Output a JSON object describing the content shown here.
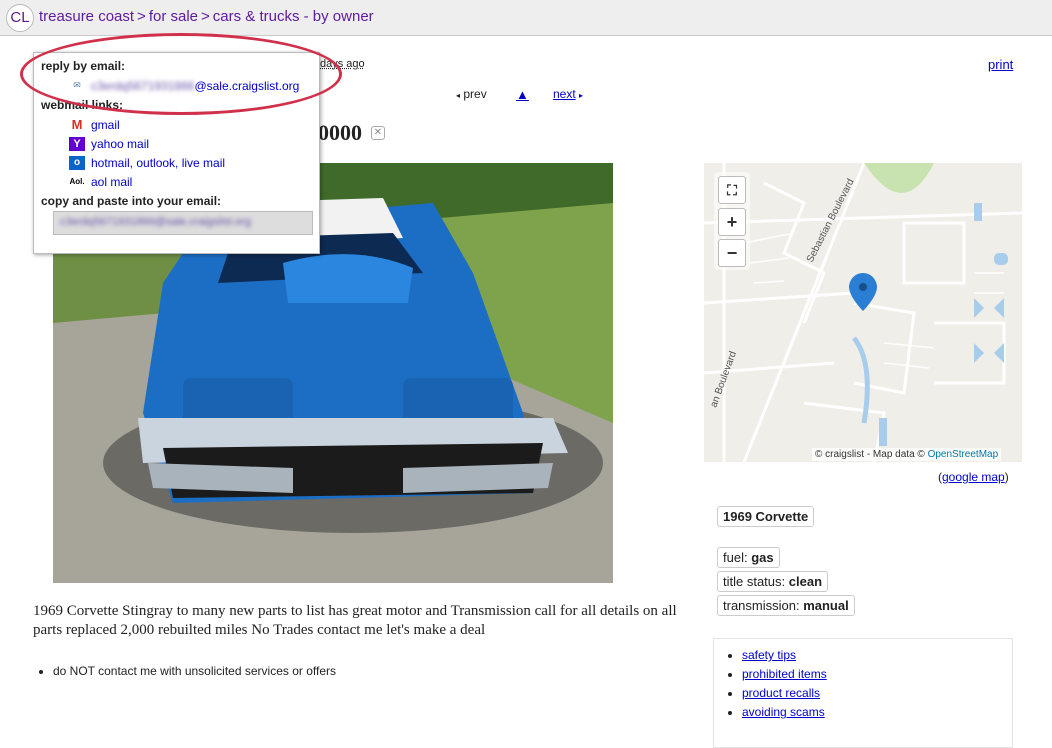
{
  "header": {
    "logo": "CL",
    "breadcrumbs": [
      "treasure coast",
      "for sale",
      "cars & trucks - by owner"
    ],
    "separator": ">"
  },
  "posting": {
    "posted_fragment": "days ago",
    "print_label": "print",
    "prev_label": "prev",
    "up_label": "▲",
    "next_label": "next",
    "title_fragment": "0000",
    "body": "1969 Corvette Stingray to many new parts to list has great motor and Transmission call for all details on all parts replaced 2,000 rebuilted miles No Trades contact me let's make a deal",
    "notices": [
      "do NOT contact me with unsolicited services or offers"
    ]
  },
  "reply_popup": {
    "reply_heading": "reply by email:",
    "email_user_blurred": "c3erdq5671931866",
    "email_domain": "@sale.craigslist.org",
    "webmail_heading": "webmail links:",
    "webmail_links": [
      {
        "label": "gmail",
        "icon": "gmail-icon",
        "color": "#d93025"
      },
      {
        "label": "yahoo mail",
        "icon": "yahoo-icon",
        "color": "#5f01d1"
      },
      {
        "label": "hotmail, outlook, live mail",
        "icon": "outlook-icon",
        "color": "#0a64c9"
      },
      {
        "label": "aol mail",
        "icon": "aol-icon",
        "color": "#000000"
      }
    ],
    "copy_heading": "copy and paste into your email:",
    "copy_value_blurred": "c3erdq5671931866@sale.craigslist.org"
  },
  "map": {
    "street_1": "Sebastian Boulevard",
    "street_2": "an Boulevard",
    "attribution_prefix": "© craigslist - Map data ©",
    "attribution_link": "OpenStreetMap",
    "google_map_label": "google map"
  },
  "attributes": {
    "name": "1969 Corvette",
    "fuel_label": "fuel:",
    "fuel_value": "gas",
    "title_label": "title status:",
    "title_value": "clean",
    "transmission_label": "transmission:",
    "transmission_value": "manual"
  },
  "safety_links": [
    "safety tips",
    "prohibited items",
    "product recalls",
    "avoiding scams"
  ],
  "colors": {
    "accent_link": "#0000cc",
    "breadcrumb": "#5f1a9e",
    "highlight_oval": "#d0304a",
    "map_pin": "#2a7fd4"
  }
}
